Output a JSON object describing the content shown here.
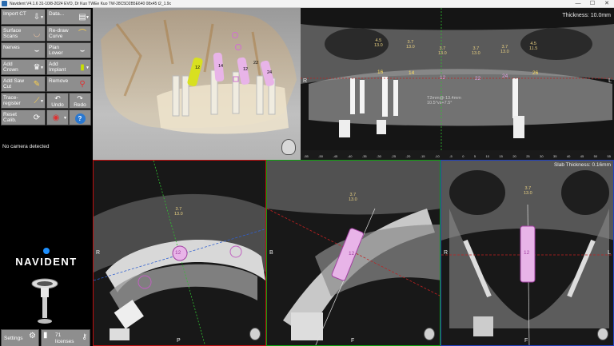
{
  "window": {
    "title": "Navident V4.1.6 31-10/8-2024 EVO, Dr Kuo TWEe Kuo TW-28C5D2B5E640 08x45 t2_1.9c",
    "btn_minimize": "—",
    "btn_maximize": "☐",
    "btn_close": "✕"
  },
  "toolbar": {
    "import_ct": "Import CT",
    "data": "Data...",
    "surface_scans": "Surface Scans",
    "redraw_curve": "Re-draw Curve",
    "nerves": "Nerves",
    "plan_lower": "Plan Lower",
    "add_crown": "Add Crown",
    "add_implant": "Add Implant",
    "add_saw_cut": "Add Saw Cut",
    "remove": "Remove",
    "trace_register": "Trace-register",
    "undo": "Undo",
    "redo": "Redo",
    "reset_calib": "Reset Calib.",
    "help": "?"
  },
  "status": {
    "camera": "No camera detected"
  },
  "logo": {
    "text": "NAVIDENT"
  },
  "bottom": {
    "settings": "Settings",
    "licenses_count": "71",
    "licenses_label": "licenses"
  },
  "panorama": {
    "thickness": "Thickness: 10.0mm",
    "left_label": "R",
    "right_label": "L",
    "implants": [
      {
        "num": "16",
        "top": "4.5",
        "bottom": "13.0"
      },
      {
        "num": "14",
        "top": "3.7",
        "bottom": "13.0"
      },
      {
        "num": "12",
        "top": "3.7",
        "bottom": "13.0"
      },
      {
        "num": "22",
        "top": "3.7",
        "bottom": "13.0"
      },
      {
        "num": "24",
        "top": "3.7",
        "bottom": "13.0"
      },
      {
        "num": "26",
        "top": "4.5",
        "bottom": "11.5"
      }
    ],
    "measure_1": "T2mm@-13.4mm",
    "measure_2": "10.5°vs+7.5°",
    "ruler": [
      "-55",
      "-50",
      "-45",
      "-40",
      "-35",
      "-30",
      "-25",
      "-20",
      "-15",
      "-10",
      "-5",
      "0",
      "5",
      "10",
      "15",
      "20",
      "25",
      "30",
      "35",
      "40",
      "45",
      "50",
      "55"
    ]
  },
  "axial": {
    "left_label": "R",
    "bottom_label": "P",
    "implant": "12",
    "size_top": "3.7",
    "size_bottom": "13.0"
  },
  "sagittal": {
    "left_label": "B",
    "bottom_label": "F",
    "implant": "12",
    "size_top": "3.7",
    "size_bottom": "13.0"
  },
  "coronal": {
    "slab": "Slab Thickness: 0.16mm",
    "left_label": "R",
    "right_label": "L",
    "bottom_label": "F",
    "implant": "12",
    "size_top": "3.7",
    "size_bottom": "13.0"
  },
  "view3d": {
    "implants": [
      "12",
      "14",
      "12",
      "22",
      "24"
    ]
  }
}
